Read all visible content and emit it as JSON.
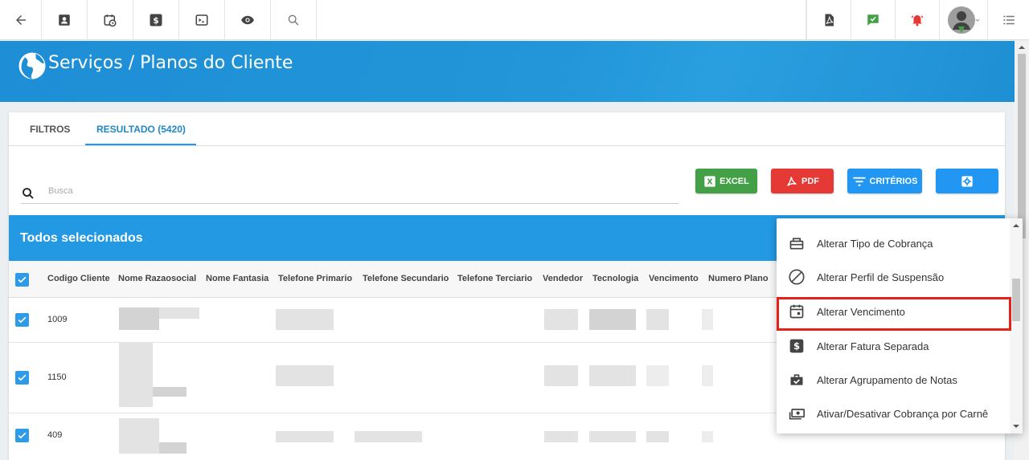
{
  "header": {
    "title": "Serviços / Planos do Cliente"
  },
  "tabs": [
    {
      "label": "FILTROS"
    },
    {
      "label": "RESULTADO (5420)"
    }
  ],
  "search": {
    "placeholder": "Busca"
  },
  "actions": {
    "excel": "EXCEL",
    "pdf": "PDF",
    "criterios": "CRITÉRIOS"
  },
  "selection_bar": {
    "text": "Todos selecionados"
  },
  "table": {
    "columns": [
      "Codigo Cliente",
      "Nome Razaosocial",
      "Nome Fantasia",
      "Telefone Primario",
      "Telefone Secundario",
      "Telefone Terciario",
      "Vendedor",
      "Tecnologia",
      "Vencimento",
      "Numero Plano"
    ],
    "rows": [
      {
        "codigo": "1009",
        "checked": true
      },
      {
        "codigo": "1150",
        "checked": true
      },
      {
        "codigo": "409",
        "checked": true
      }
    ]
  },
  "context_menu": {
    "items": [
      {
        "label": "Alterar Tipo de Cobrança",
        "icon": "billing-type-icon"
      },
      {
        "label": "Alterar Perfil de Suspensão",
        "icon": "block-icon"
      },
      {
        "label": "Alterar Vencimento",
        "icon": "calendar-icon",
        "highlighted": true
      },
      {
        "label": "Alterar Fatura Separada",
        "icon": "dollar-icon"
      },
      {
        "label": "Alterar Agrupamento de Notas",
        "icon": "briefcase-check-icon"
      },
      {
        "label": "Ativar/Desativar Cobrança por Carnê",
        "icon": "cash-icon"
      }
    ]
  },
  "colors": {
    "header_blue": "#1e8ed6",
    "selection_blue": "#2499e3",
    "excel_green": "#43a047",
    "pdf_red": "#e53935",
    "highlight_red": "#e8201a"
  }
}
